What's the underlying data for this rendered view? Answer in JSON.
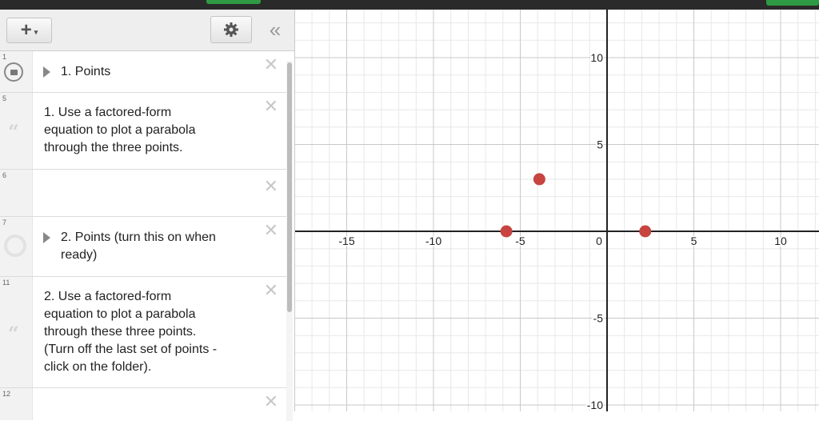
{
  "toolbar": {
    "add_label": "+",
    "add_caret": "▾",
    "gear_icon": "gear-icon",
    "collapse_label": "«"
  },
  "expressions": [
    {
      "num": "1",
      "kind": "folder",
      "text": "1. Points"
    },
    {
      "num": "5",
      "kind": "note",
      "lines": [
        "1. Use a factored-form",
        "equation to plot a parabola",
        "through the three points."
      ]
    },
    {
      "num": "6",
      "kind": "empty"
    },
    {
      "num": "7",
      "kind": "folder",
      "lines": [
        "2. Points (turn this on when",
        "ready)"
      ]
    },
    {
      "num": "11",
      "kind": "note",
      "lines": [
        "2. Use a factored-form",
        "equation to plot a parabola",
        "through these three points.",
        "(Turn off the last set of points -",
        "click on the folder)."
      ]
    },
    {
      "num": "12",
      "kind": "empty"
    }
  ],
  "graph": {
    "x_ticks": [
      "-15",
      "-10",
      "-5",
      "0",
      "5",
      "10"
    ],
    "y_ticks": [
      "10",
      "5",
      "-5",
      "-10"
    ],
    "point_color": "#c74440",
    "points": [
      {
        "x": -5.8,
        "y": 0
      },
      {
        "x": -3.9,
        "y": 3
      },
      {
        "x": 2.2,
        "y": 0
      }
    ]
  }
}
